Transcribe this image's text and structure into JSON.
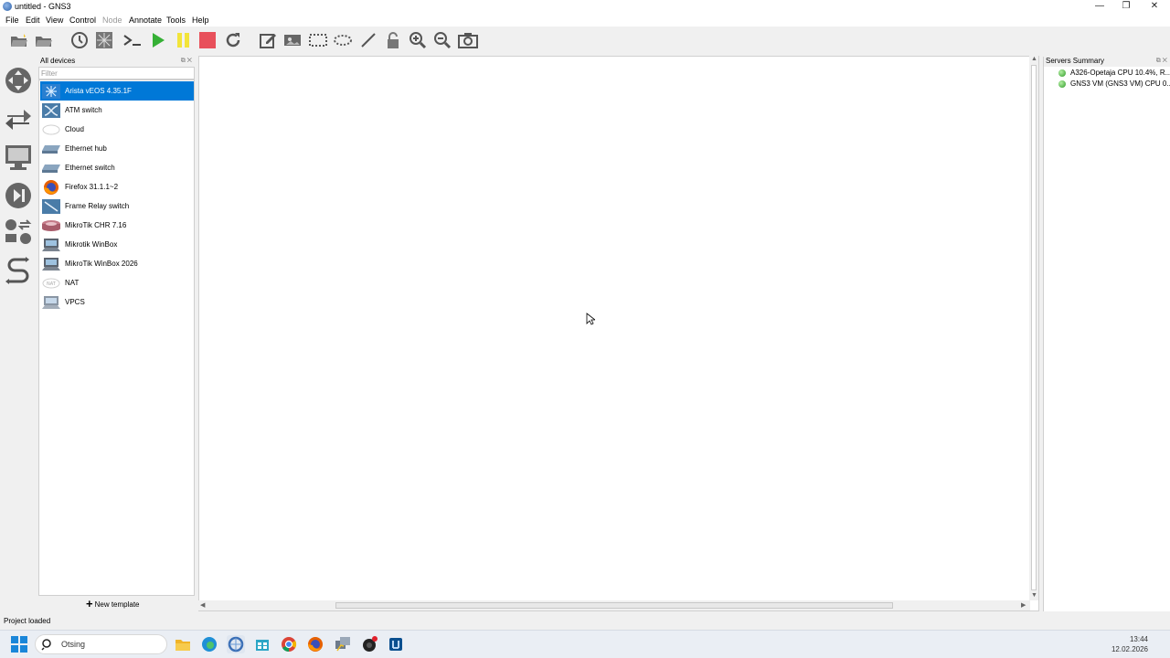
{
  "window": {
    "title": "untitled - GNS3",
    "controls": [
      "—",
      "❐",
      "✕"
    ]
  },
  "menu": [
    {
      "label": "File",
      "enabled": true
    },
    {
      "label": "Edit",
      "enabled": true
    },
    {
      "label": "View",
      "enabled": true
    },
    {
      "label": "Control",
      "enabled": true
    },
    {
      "label": "Node",
      "enabled": false
    },
    {
      "label": "Annotate",
      "enabled": true
    },
    {
      "label": "Tools",
      "enabled": true
    },
    {
      "label": "Help",
      "enabled": true
    }
  ],
  "toolbar": [
    "open-folder-icon",
    "open-project-icon",
    "snapshot-icon",
    "show-interface-labels-icon",
    "console-icon",
    "start-all-icon",
    "suspend-all-icon",
    "stop-all-icon",
    "reload-all-icon",
    "add-note-icon",
    "insert-picture-icon",
    "draw-rectangle-icon",
    "draw-ellipse-icon",
    "draw-line-icon",
    "lock-icon",
    "zoom-in-icon",
    "zoom-out-icon",
    "screenshot-icon"
  ],
  "devices_panel": {
    "title": "All devices",
    "filter_placeholder": "Filter",
    "items": [
      {
        "label": "Arista vEOS 4.35.1F",
        "icon": "arista-icon",
        "selected": true
      },
      {
        "label": "ATM switch",
        "icon": "atm-switch-icon",
        "selected": false
      },
      {
        "label": "Cloud",
        "icon": "cloud-icon",
        "selected": false
      },
      {
        "label": "Ethernet hub",
        "icon": "ethernet-hub-icon",
        "selected": false
      },
      {
        "label": "Ethernet switch",
        "icon": "ethernet-switch-icon",
        "selected": false
      },
      {
        "label": "Firefox 31.1.1~2",
        "icon": "firefox-icon",
        "selected": false
      },
      {
        "label": "Frame Relay switch",
        "icon": "frame-relay-switch-icon",
        "selected": false
      },
      {
        "label": "MikroTik CHR 7.16",
        "icon": "router-icon",
        "selected": false
      },
      {
        "label": "Mikrotik WinBox",
        "icon": "computer-icon",
        "selected": false
      },
      {
        "label": "MikroTik WinBox 2026",
        "icon": "computer-icon",
        "selected": false
      },
      {
        "label": "NAT",
        "icon": "nat-icon",
        "selected": false
      },
      {
        "label": "VPCS",
        "icon": "vpcs-icon",
        "selected": false
      }
    ],
    "new_template_label": "New template"
  },
  "servers_panel": {
    "title": "Servers Summary",
    "servers": [
      {
        "label": "A326-Opetaja CPU 10.4%, R..."
      },
      {
        "label": "GNS3 VM (GNS3 VM) CPU 0..."
      }
    ]
  },
  "status": "Project loaded",
  "taskbar": {
    "search_placeholder": "Otsing",
    "apps": [
      "file-explorer-icon",
      "edge-icon",
      "gns3-icon",
      "store-icon",
      "chrome-icon",
      "firefox-icon",
      "putty-icon",
      "recorder-icon",
      "app-icon"
    ],
    "time": "13:44",
    "date": "12.02.2026"
  },
  "colors": {
    "selection": "#0078d7",
    "start": "#35b035",
    "suspend": "#f2e43a",
    "stop": "#e8505b"
  }
}
